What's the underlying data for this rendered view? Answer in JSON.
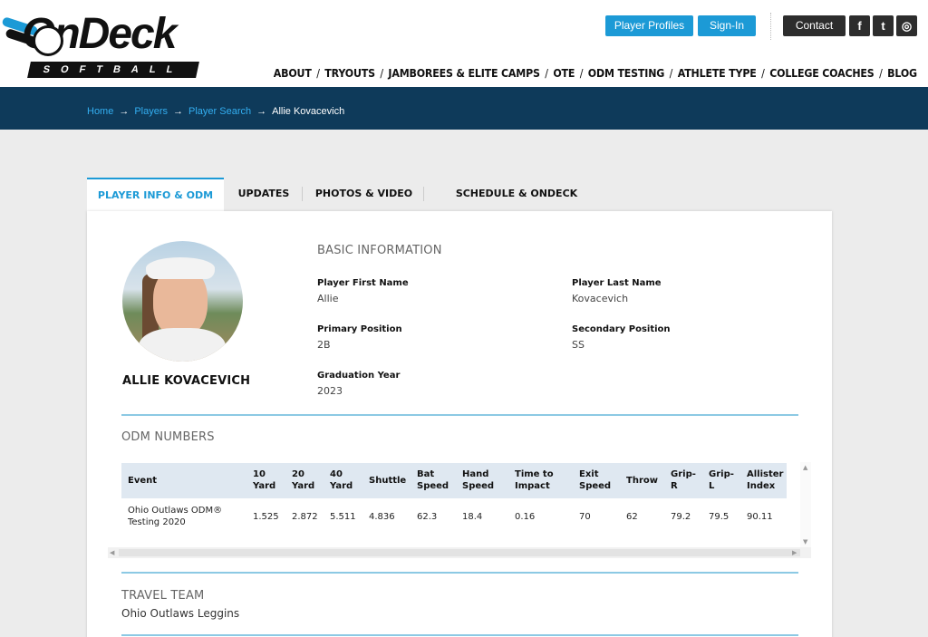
{
  "brand": {
    "name_top": "OnDeck",
    "name_bottom": "SOFTBALL"
  },
  "header": {
    "player_profiles": "Player Profiles",
    "sign_in": "Sign-In",
    "contact": "Contact",
    "social": [
      "f",
      "t",
      "◎"
    ],
    "social_icons": [
      "facebook-icon",
      "twitter-icon",
      "instagram-icon"
    ],
    "nav": [
      "ABOUT",
      "TRYOUTS",
      "JAMBOREES & ELITE CAMPS",
      "OTE",
      "ODM TESTING",
      "ATHLETE TYPE",
      "COLLEGE COACHES",
      "BLOG"
    ]
  },
  "breadcrumb": {
    "home": "Home",
    "players": "Players",
    "player_search": "Player Search",
    "current": "Allie Kovacevich",
    "arrow": "→"
  },
  "tabs": [
    "PLAYER INFO & ODM",
    "UPDATES",
    "PHOTOS & VIDEO",
    "SCHEDULE & ONDECK EVENTS"
  ],
  "player": {
    "display_name": "ALLIE KOVACEVICH"
  },
  "basic_info": {
    "title": "BASIC INFORMATION",
    "first_name_label": "Player First Name",
    "first_name": "Allie",
    "last_name_label": "Player Last Name",
    "last_name": "Kovacevich",
    "primary_label": "Primary Position",
    "primary": "2B",
    "secondary_label": "Secondary Position",
    "secondary": "SS",
    "grad_label": "Graduation Year",
    "grad": "2023"
  },
  "odm": {
    "title": "ODM NUMBERS",
    "headers": [
      "Event",
      "10 Yard",
      "20 Yard",
      "40 Yard",
      "Shuttle",
      "Bat Speed",
      "Hand Speed",
      "Time to Impact",
      "Exit Speed",
      "Throw",
      "Grip-R",
      "Grip-L",
      "Allister Index"
    ],
    "rows": [
      [
        "Ohio Outlaws ODM® Testing 2020",
        "1.525",
        "2.872",
        "5.511",
        "4.836",
        "62.3",
        "18.4",
        "0.16",
        "70",
        "62",
        "79.2",
        "79.5",
        "90.11"
      ]
    ]
  },
  "travel_team": {
    "title": "TRAVEL TEAM",
    "value": "Ohio Outlaws Leggins"
  },
  "colors": {
    "accent": "#1c9ad6",
    "navy": "#0e3a5a",
    "divider": "#8cc9e4"
  }
}
